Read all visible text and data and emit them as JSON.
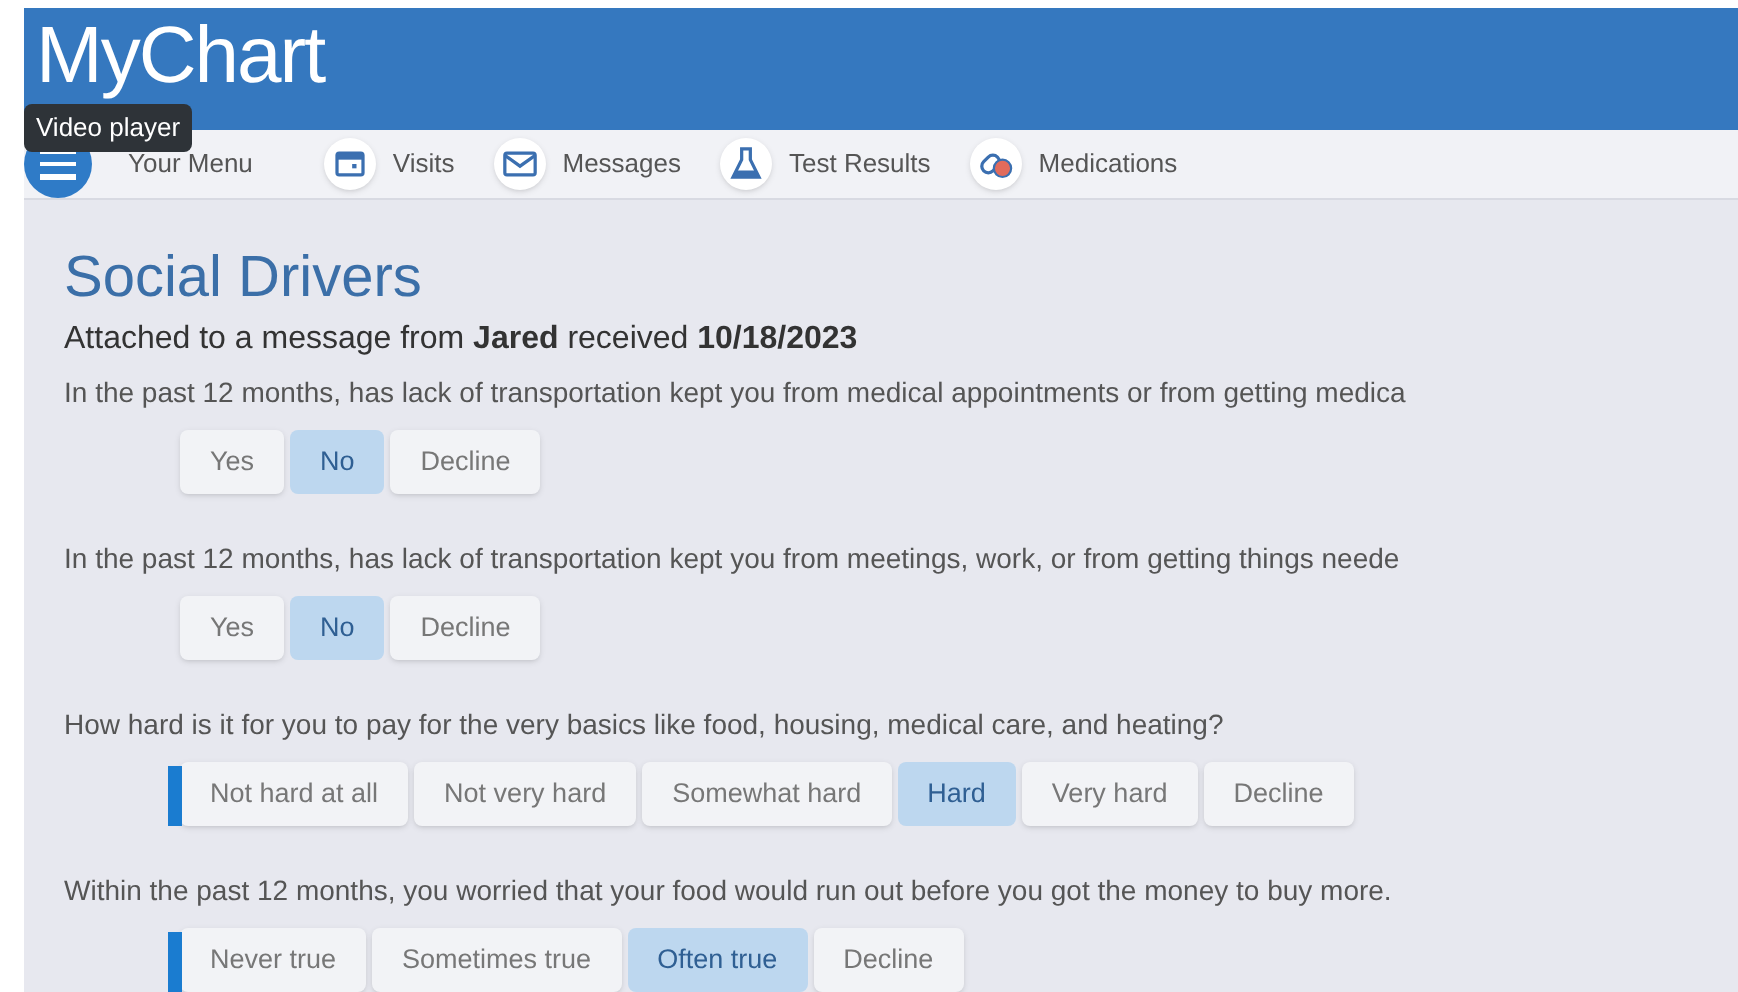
{
  "header": {
    "logo": "MyChart",
    "tooltip": "Video player"
  },
  "nav": {
    "menu_label": "Your Menu",
    "items": [
      {
        "label": "Visits",
        "kind": "calendar"
      },
      {
        "label": "Messages",
        "kind": "envelope"
      },
      {
        "label": "Test Results",
        "kind": "flask"
      },
      {
        "label": "Medications",
        "kind": "pills"
      }
    ]
  },
  "page": {
    "title": "Social Drivers",
    "subtitle": "Attached to a message from **Jared** received **10/18/2023**"
  },
  "questions": [
    {
      "text": "In the past 12 months, has lack of transportation kept you from medical appointments or from getting medica",
      "marker": false,
      "options": [
        {
          "label": "Yes",
          "selected": false
        },
        {
          "label": "No",
          "selected": true
        },
        {
          "label": "Decline",
          "selected": false
        }
      ]
    },
    {
      "text": "In the past 12 months, has lack of transportation kept you from meetings, work, or from getting things neede",
      "marker": false,
      "options": [
        {
          "label": "Yes",
          "selected": false
        },
        {
          "label": "No",
          "selected": true
        },
        {
          "label": "Decline",
          "selected": false
        }
      ]
    },
    {
      "text": "How hard is it for you to pay for the very basics like food, housing, medical care, and heating?",
      "marker": true,
      "options": [
        {
          "label": "Not hard at all",
          "selected": false
        },
        {
          "label": "Not very hard",
          "selected": false
        },
        {
          "label": "Somewhat hard",
          "selected": false
        },
        {
          "label": "Hard",
          "selected": true
        },
        {
          "label": "Very hard",
          "selected": false
        },
        {
          "label": "Decline",
          "selected": false
        }
      ]
    },
    {
      "text": "Within the past 12 months, you worried that your food would run out before you got the money to buy more.",
      "marker": true,
      "options": [
        {
          "label": "Never true",
          "selected": false
        },
        {
          "label": "Sometimes true",
          "selected": false
        },
        {
          "label": "Often true",
          "selected": true
        },
        {
          "label": "Decline",
          "selected": false
        }
      ]
    }
  ]
}
